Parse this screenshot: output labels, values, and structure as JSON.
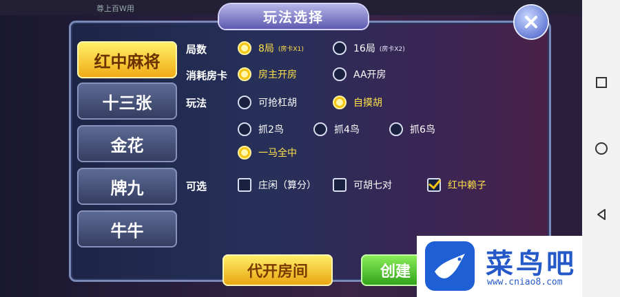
{
  "dialog": {
    "title": "玩法选择"
  },
  "background": {
    "status_text": "尊上百W用"
  },
  "game_tabs": [
    {
      "label": "红中麻将",
      "active": true
    },
    {
      "label": "十三张",
      "active": false
    },
    {
      "label": "金花",
      "active": false
    },
    {
      "label": "牌九",
      "active": false
    },
    {
      "label": "牛牛",
      "active": false
    }
  ],
  "rounds": {
    "label": "局数",
    "options": [
      {
        "label": "8局",
        "sub": "(房卡X1)",
        "selected": true
      },
      {
        "label": "16局",
        "sub": "(房卡X2)",
        "selected": false
      }
    ]
  },
  "card_cost": {
    "label": "消耗房卡",
    "options": [
      {
        "label": "房主开房",
        "selected": true
      },
      {
        "label": "AA开房",
        "selected": false
      }
    ]
  },
  "play": {
    "label": "玩法",
    "options": [
      {
        "label": "可抢杠胡",
        "selected": false
      },
      {
        "label": "自摸胡",
        "selected": true
      }
    ]
  },
  "birds": {
    "options": [
      {
        "label": "抓2鸟",
        "selected": false
      },
      {
        "label": "抓4鸟",
        "selected": false
      },
      {
        "label": "抓6鸟",
        "selected": false
      },
      {
        "label": "一马全中",
        "selected": true
      }
    ]
  },
  "optional": {
    "label": "可选",
    "options": [
      {
        "label": "庄闲（算分）",
        "checked": false
      },
      {
        "label": "可胡七对",
        "checked": false
      },
      {
        "label": "红中赖子",
        "checked": true
      }
    ]
  },
  "buttons": {
    "create_for_others": "代开房间",
    "create": "创建"
  },
  "watermark": {
    "title": "菜鸟吧",
    "url": "www.cniao8.com"
  },
  "colors": {
    "selected": "#f5c510",
    "accent_text": "#ffe24a",
    "panel": "#263059"
  }
}
